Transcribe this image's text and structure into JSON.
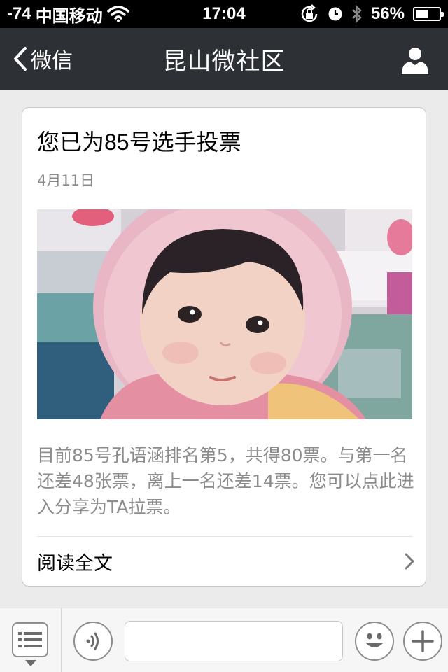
{
  "status_bar": {
    "signal": "-74",
    "carrier": "中国移动",
    "time": "17:04",
    "battery": "56%",
    "battery_level": 0.56
  },
  "nav": {
    "back_label": "微信",
    "title": "昆山微社区"
  },
  "article": {
    "title": "您已为85号选手投票",
    "date": "4月11日",
    "description": "目前85号孔语涵排名第5，共得80票。与第一名还差48张票，离上一名还差14票。您可以点此进入分享为TA拉票。",
    "read_more": "阅读全文"
  },
  "toolbar": {
    "input_value": ""
  },
  "colors": {
    "nav_bg": "#2d3135",
    "page_bg": "#ebebeb",
    "secondary_text": "#8c8c8c"
  }
}
